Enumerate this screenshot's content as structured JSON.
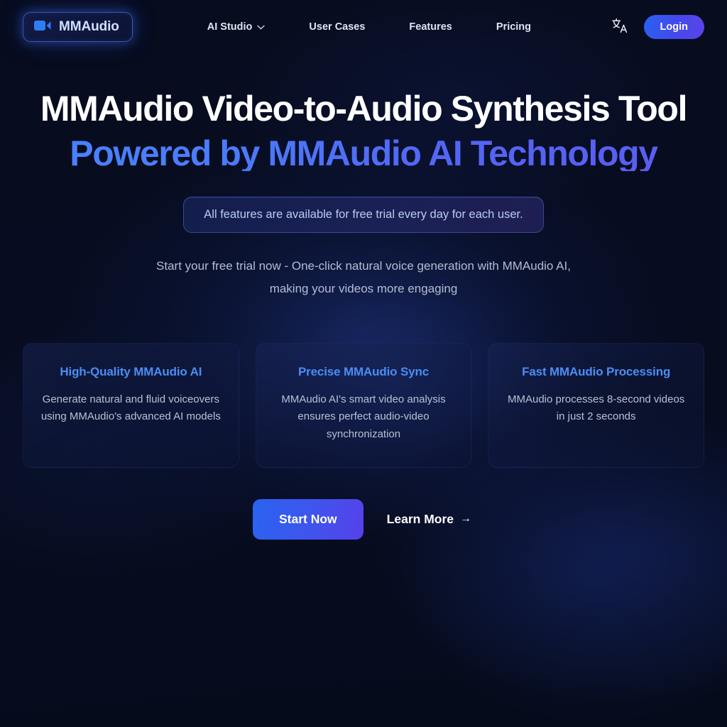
{
  "brand": {
    "name": "MMAudio",
    "icon": "video-camera-icon"
  },
  "nav": {
    "links": [
      {
        "label": "AI Studio",
        "has_dropdown": true
      },
      {
        "label": "User Cases",
        "has_dropdown": false
      },
      {
        "label": "Features",
        "has_dropdown": false
      },
      {
        "label": "Pricing",
        "has_dropdown": false
      }
    ],
    "language_icon": "translate-icon",
    "login_label": "Login",
    "login_color": "#2a61f0"
  },
  "hero": {
    "title_line1": "MMAudio Video-to-Audio Synthesis Tool",
    "title_line2": "Powered by MMAudio AI Technology",
    "gradient_from": "#4a82fb",
    "gradient_to": "#5b5cf0",
    "badge": "All features are available for free trial every day for each user.",
    "subtitle_line1": "Start your free trial now - One-click natural voice generation with MMAudio AI,",
    "subtitle_line2": "making your videos more engaging"
  },
  "cards": [
    {
      "title": "High-Quality MMAudio AI",
      "desc": "Generate natural and fluid voiceovers using MMAudio's advanced AI models"
    },
    {
      "title": "Precise MMAudio Sync",
      "desc": "MMAudio AI's smart video analysis ensures perfect audio-video synchronization"
    },
    {
      "title": "Fast MMAudio Processing",
      "desc": "MMAudio processes 8-second videos in just 2 seconds"
    }
  ],
  "cta": {
    "primary_label": "Start Now",
    "secondary_label": "Learn More",
    "secondary_arrow": "→"
  }
}
